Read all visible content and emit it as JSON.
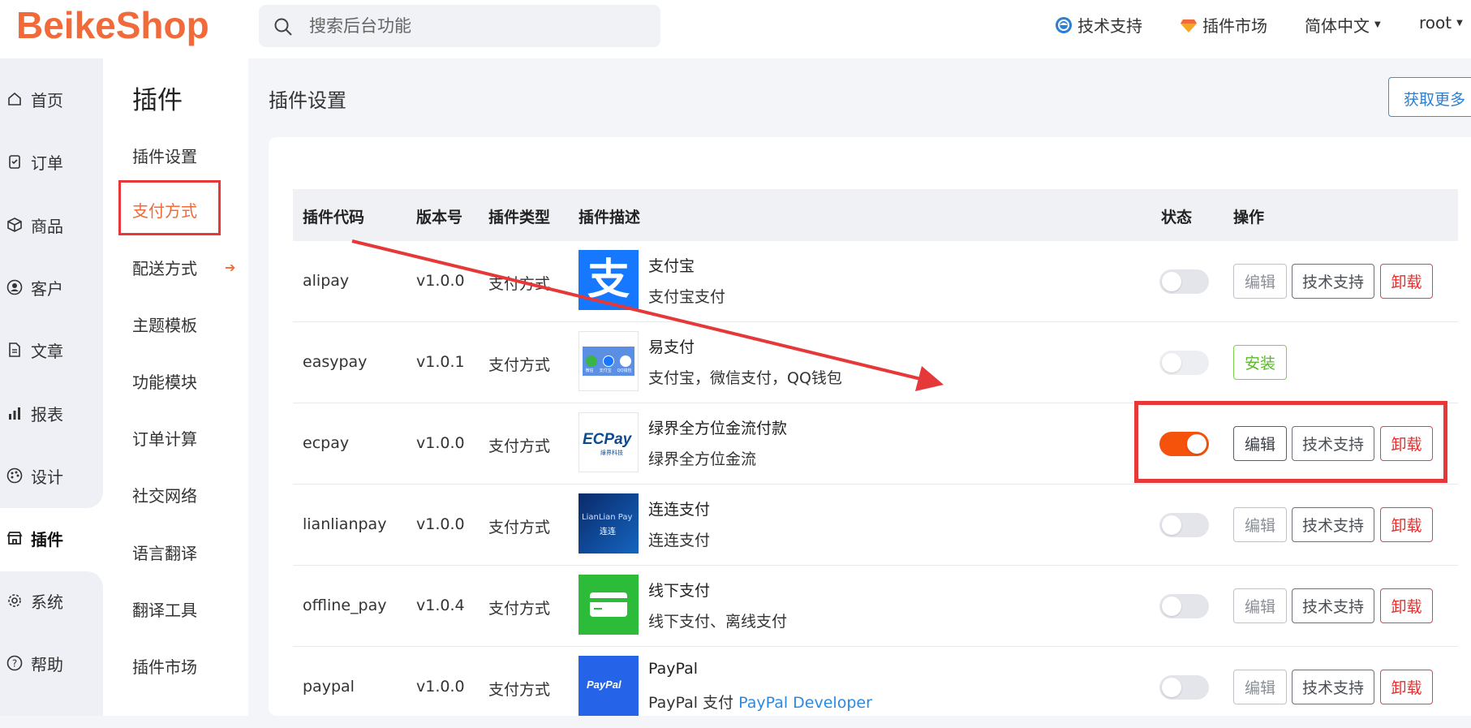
{
  "header": {
    "logo": "BeikeShop",
    "search_placeholder": "搜索后台功能",
    "support": "技术支持",
    "market": "插件市场",
    "language": "简体中文",
    "user": "root"
  },
  "main_nav": [
    {
      "label": "首页",
      "icon": "home-icon"
    },
    {
      "label": "订单",
      "icon": "clipboard-icon"
    },
    {
      "label": "商品",
      "icon": "box-icon"
    },
    {
      "label": "客户",
      "icon": "user-icon"
    },
    {
      "label": "文章",
      "icon": "document-icon"
    },
    {
      "label": "报表",
      "icon": "chart-icon"
    },
    {
      "label": "设计",
      "icon": "palette-icon"
    },
    {
      "label": "插件",
      "icon": "store-icon"
    },
    {
      "label": "系统",
      "icon": "gear-icon"
    },
    {
      "label": "帮助",
      "icon": "help-icon"
    }
  ],
  "sub_nav": {
    "title": "插件",
    "items": [
      "插件设置",
      "支付方式",
      "配送方式",
      "主题模板",
      "功能模块",
      "订单计算",
      "社交网络",
      "语言翻译",
      "翻译工具",
      "插件市场"
    ],
    "active": "支付方式"
  },
  "page": {
    "title": "插件设置",
    "get_more": "获取更多"
  },
  "table": {
    "headers": {
      "code": "插件代码",
      "version": "版本号",
      "type": "插件类型",
      "desc": "插件描述",
      "status": "状态",
      "ops": "操作"
    },
    "rows": [
      {
        "code": "alipay",
        "version": "v1.0.0",
        "type": "支付方式",
        "name": "支付宝",
        "desc": "支付宝支付",
        "status": "off",
        "installed": true
      },
      {
        "code": "easypay",
        "version": "v1.0.1",
        "type": "支付方式",
        "name": "易支付",
        "desc": "支付宝，微信支付，QQ钱包",
        "status": "off",
        "installed": false
      },
      {
        "code": "ecpay",
        "version": "v1.0.0",
        "type": "支付方式",
        "name": "绿界全方位金流付款",
        "desc": "绿界全方位金流",
        "status": "on",
        "installed": true
      },
      {
        "code": "lianlianpay",
        "version": "v1.0.0",
        "type": "支付方式",
        "name": "连连支付",
        "desc": "连连支付",
        "status": "off",
        "installed": true
      },
      {
        "code": "offline_pay",
        "version": "v1.0.4",
        "type": "支付方式",
        "name": "线下支付",
        "desc": "线下支付、离线支付",
        "status": "off",
        "installed": true
      },
      {
        "code": "paypal",
        "version": "v1.0.0",
        "type": "支付方式",
        "name": "PayPal",
        "desc": "PayPal 支付",
        "desc_link": "PayPal Developer",
        "status": "off",
        "installed": true
      }
    ],
    "buttons": {
      "edit": "编辑",
      "support": "技术支持",
      "uninstall": "卸载",
      "install": "安装"
    }
  },
  "logos": {
    "alipay_glyph": "支",
    "easypay_labels": [
      "微信",
      "支付宝",
      "QQ钱包"
    ],
    "ecpay_text": "ECPay",
    "ecpay_sub": "綠界科技",
    "lianlian_text": "LianLian Pay",
    "lianlian_sub": "连连",
    "paypal_text": "PayPal"
  },
  "colors": {
    "brand": "#f16a3a",
    "toggle_on": "#f5520c",
    "danger": "#e03030",
    "success": "#5ab82a",
    "link": "#2a8ae3",
    "annotation": "#e63838"
  }
}
